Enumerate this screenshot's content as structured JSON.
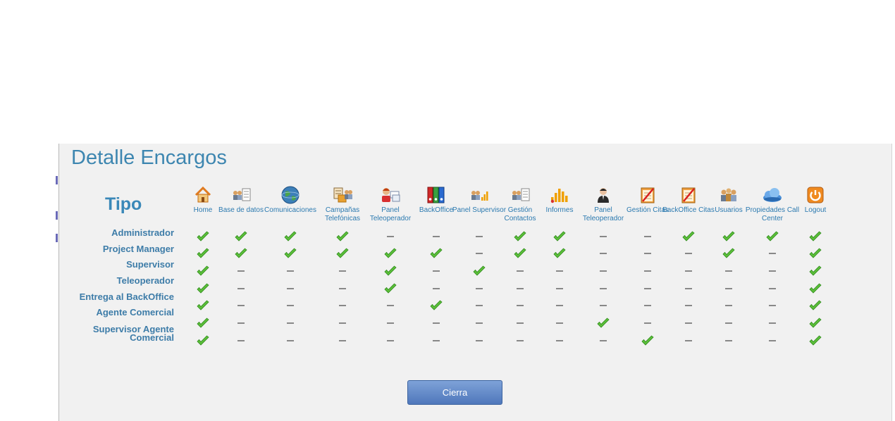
{
  "dialog": {
    "title": "Detalle Encargos",
    "tipo_label": "Tipo"
  },
  "columns": [
    {
      "label": "Home",
      "icon": "home-icon"
    },
    {
      "label": "Base de datos",
      "icon": "database-icon"
    },
    {
      "label": "Comunicaciones",
      "icon": "globe-icon"
    },
    {
      "label": "Campañas Telefónicas",
      "icon": "campaign-icon"
    },
    {
      "label": "Panel Teleoperador",
      "icon": "operator-panel-icon"
    },
    {
      "label": "BackOffice",
      "icon": "binders-icon"
    },
    {
      "label": "Panel Supervisor",
      "icon": "supervisor-panel-icon"
    },
    {
      "label": "Gestión Contactos",
      "icon": "contacts-icon"
    },
    {
      "label": "Informes",
      "icon": "reports-chart-icon"
    },
    {
      "label": "Panel Teleoperador",
      "icon": "agent-icon"
    },
    {
      "label": "Gestión Citas",
      "icon": "notepad-icon"
    },
    {
      "label": "BackOffice Citas",
      "icon": "notepad-icon"
    },
    {
      "label": "Usuarios",
      "icon": "users-icon"
    },
    {
      "label": "Propiedades Call Center",
      "icon": "cloud-icon"
    },
    {
      "label": "Logout",
      "icon": "power-icon"
    }
  ],
  "rows": [
    {
      "label": "Administrador",
      "perms": [
        1,
        1,
        1,
        1,
        0,
        0,
        0,
        1,
        1,
        0,
        0,
        1,
        1,
        1,
        1
      ]
    },
    {
      "label": "Project Manager",
      "perms": [
        1,
        1,
        1,
        1,
        1,
        1,
        0,
        1,
        1,
        0,
        0,
        0,
        1,
        0,
        1
      ]
    },
    {
      "label": "Supervisor",
      "perms": [
        1,
        0,
        0,
        0,
        1,
        0,
        1,
        0,
        0,
        0,
        0,
        0,
        0,
        0,
        1
      ]
    },
    {
      "label": "Teleoperador",
      "perms": [
        1,
        0,
        0,
        0,
        1,
        0,
        0,
        0,
        0,
        0,
        0,
        0,
        0,
        0,
        1
      ]
    },
    {
      "label": "Entrega al BackOffice",
      "perms": [
        1,
        0,
        0,
        0,
        0,
        1,
        0,
        0,
        0,
        0,
        0,
        0,
        0,
        0,
        1
      ]
    },
    {
      "label": "Agente Comercial",
      "perms": [
        1,
        0,
        0,
        0,
        0,
        0,
        0,
        0,
        0,
        1,
        0,
        0,
        0,
        0,
        1
      ]
    },
    {
      "label": "Supervisor Agente Comercial",
      "perms": [
        1,
        0,
        0,
        0,
        0,
        0,
        0,
        0,
        0,
        0,
        1,
        0,
        0,
        0,
        1
      ]
    }
  ],
  "close_button": {
    "label": "Cierra"
  },
  "colors": {
    "title": "#3d86b0",
    "label": "#3d7ca8",
    "check": "#5cbf3a",
    "dash": "#888888",
    "button": "#5b83c4"
  }
}
